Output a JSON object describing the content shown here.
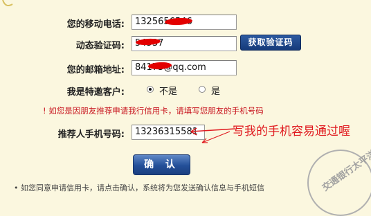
{
  "form": {
    "phone_label": "您的移动电话:",
    "phone_value": "1325656546",
    "code_label": "动态验证码:",
    "code_value": "54537",
    "get_code_button": "获取验证码",
    "email_label": "您的邮箱地址:",
    "email_prefix": "84173",
    "email_suffix": "@qq.com",
    "invited_label": "我是特邀客户:",
    "option_no": "不是",
    "option_yes": "是",
    "selected_option": "不是",
    "hint": "! 如您是因朋友推荐申请我行信用卡，请填写您朋友的手机号码",
    "referrer_label": "推荐人手机号码:",
    "referrer_value": "13236315581",
    "confirm_button": "确 认"
  },
  "annotation": {
    "text": "写我的手机容易通过喔",
    "color": "#e0191e"
  },
  "footer": {
    "text": "• 如您同意申请信用卡，请点击确认，系统将为您发送确认信息与手机短信"
  },
  "watermark": {
    "text": "交通银行太平洋"
  },
  "colors": {
    "background": "#fbf7df",
    "button_blue": "#234f98",
    "hint_red": "#c8141e"
  }
}
